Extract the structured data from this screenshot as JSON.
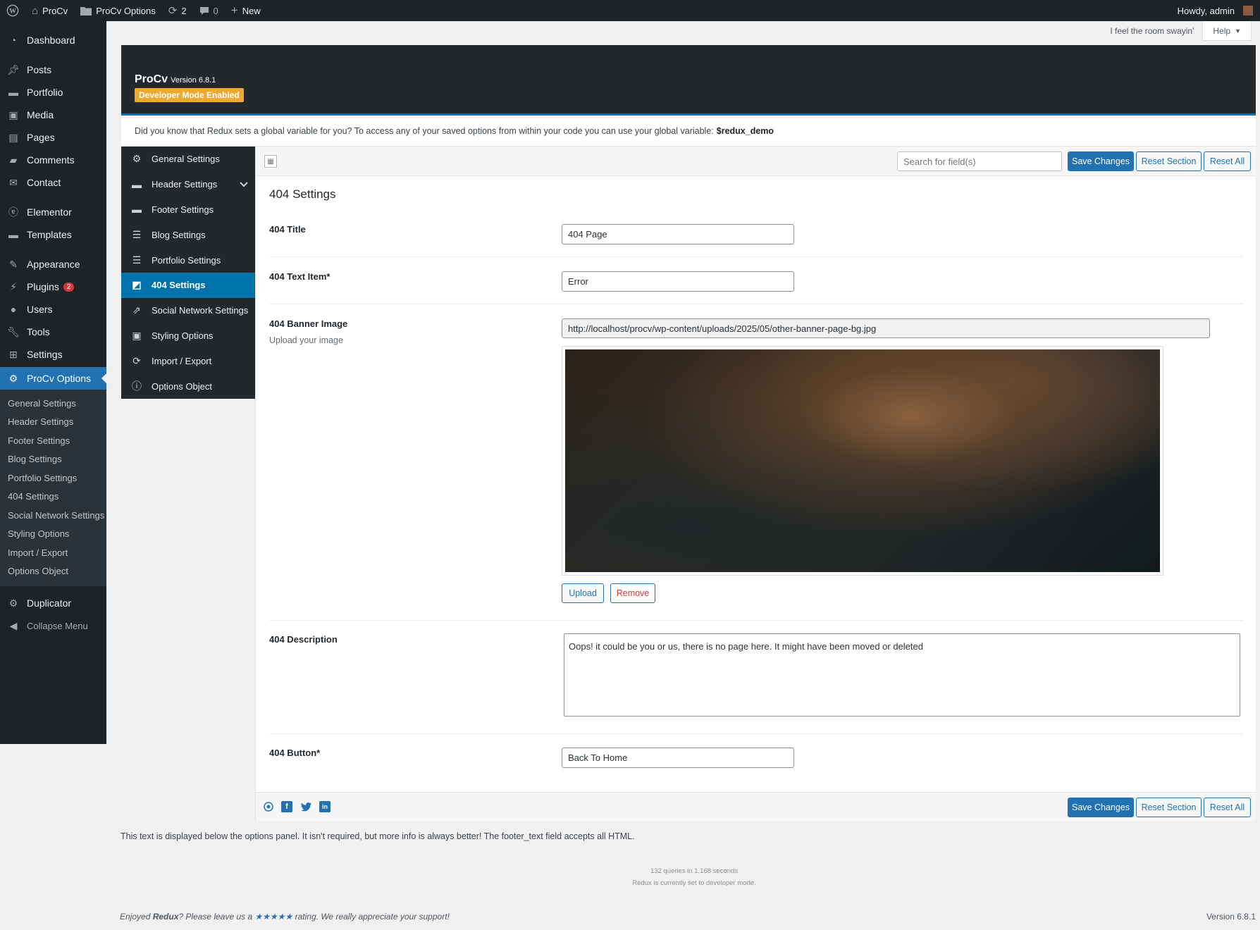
{
  "adminbar": {
    "site_name": "ProCv",
    "options_link": "ProCv Options",
    "updates_count": "2",
    "comments_count": "0",
    "new_label": "New",
    "howdy": "Howdy, admin"
  },
  "adminmenu": {
    "items": [
      {
        "label": "Dashboard",
        "icon": "dashboard-icon"
      },
      {
        "label": "Posts",
        "icon": "pin-icon"
      },
      {
        "label": "Portfolio",
        "icon": "folder-icon"
      },
      {
        "label": "Media",
        "icon": "media-icon"
      },
      {
        "label": "Pages",
        "icon": "pages-icon"
      },
      {
        "label": "Comments",
        "icon": "comment-icon"
      },
      {
        "label": "Contact",
        "icon": "mail-icon"
      },
      {
        "label": "Elementor",
        "icon": "elementor-icon"
      },
      {
        "label": "Templates",
        "icon": "folder-icon"
      },
      {
        "label": "Appearance",
        "icon": "brush-icon"
      },
      {
        "label": "Plugins",
        "icon": "plug-icon",
        "badge": "2"
      },
      {
        "label": "Users",
        "icon": "user-icon"
      },
      {
        "label": "Tools",
        "icon": "wrench-icon"
      },
      {
        "label": "Settings",
        "icon": "settings-icon"
      },
      {
        "label": "ProCv Options",
        "icon": "gear-icon"
      }
    ],
    "submenu": [
      "General Settings",
      "Header Settings",
      "Footer Settings",
      "Blog Settings",
      "Portfolio Settings",
      "404 Settings",
      "Social Network Settings",
      "Styling Options",
      "Import / Export",
      "Options Object"
    ],
    "duplicator": "Duplicator",
    "collapse": "Collapse Menu"
  },
  "screen_meta": {
    "tagline": "I feel the room swayin'",
    "help": "Help"
  },
  "redux": {
    "title": "ProCv",
    "version": "Version 6.8.1",
    "dev_badge": "Developer Mode Enabled",
    "intro": "Did you know that Redux sets a global variable for you? To access any of your saved options from within your code you can use your global variable:",
    "intro_var": "$redux_demo",
    "sidebar": [
      {
        "label": "General Settings",
        "icon": "gears-icon"
      },
      {
        "label": "Header Settings",
        "icon": "header-icon"
      },
      {
        "label": "Footer Settings",
        "icon": "footer-icon"
      },
      {
        "label": "Blog Settings",
        "icon": "list-icon"
      },
      {
        "label": "Portfolio Settings",
        "icon": "list-icon"
      },
      {
        "label": "404 Settings",
        "icon": "chart-icon"
      },
      {
        "label": "Social Network Settings",
        "icon": "share-icon"
      },
      {
        "label": "Styling Options",
        "icon": "window-icon"
      },
      {
        "label": "Import / Export",
        "icon": "refresh-icon"
      },
      {
        "label": "Options Object",
        "icon": "info-icon"
      }
    ],
    "toolbar": {
      "search_placeholder": "Search for field(s)",
      "save": "Save Changes",
      "reset_section": "Reset Section",
      "reset_all": "Reset All"
    },
    "section_title": "404 Settings",
    "fields": {
      "title_label": "404 Title",
      "title_value": "404 Page",
      "text_item_label": "404 Text Item*",
      "text_item_value": "Error",
      "banner_label": "404 Banner Image",
      "banner_sub": "Upload your image",
      "banner_url": "http://localhost/procv/wp-content/uploads/2025/05/other-banner-page-bg.jpg",
      "upload": "Upload",
      "remove": "Remove",
      "description_label": "404 Description",
      "description_value": "Oops! it could be you or us, there is no page here. It might have been moved or deleted",
      "button_label": "404 Button*",
      "button_value": "Back To Home"
    },
    "footer_text": "This text is displayed below the options panel. It isn't required, but more info is always better! The footer_text field accepts all HTML.",
    "queries": "132 queries in 1.168 seconds",
    "dev_mode_note": "Redux is currently set to developer mode.",
    "enjoyed_prefix": "Enjoyed",
    "enjoyed_brand": "Redux",
    "enjoyed_mid": "? Please leave us a",
    "enjoyed_stars": "★★★★★",
    "enjoyed_suffix": "rating. We really appreciate your support!"
  },
  "colors": {
    "admin_dark": "#1d2327",
    "accent": "#2271b1",
    "redux_active": "#0073aa",
    "dev_badge": "#f0a830"
  }
}
